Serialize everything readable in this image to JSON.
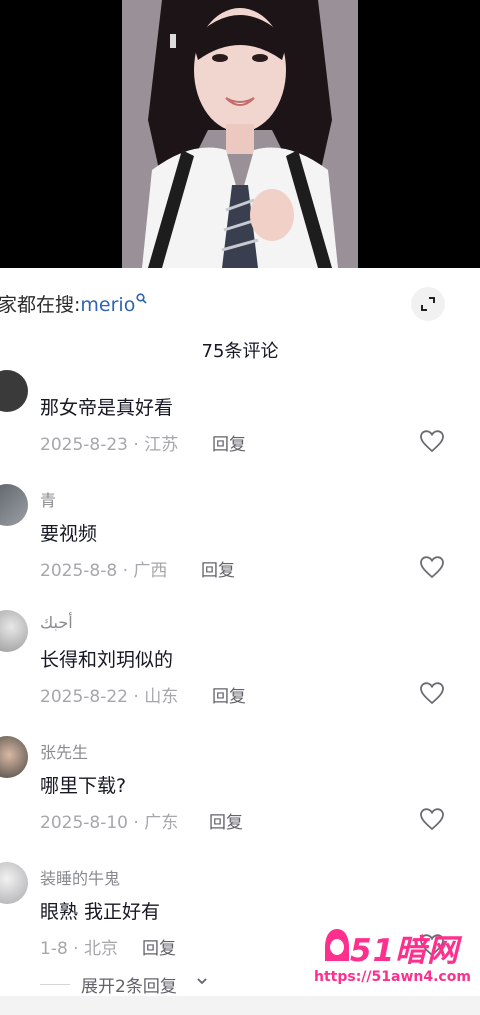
{
  "search": {
    "prefix": "家都在搜:",
    "term": "merio"
  },
  "comments_header": {
    "count_label": "75条评论"
  },
  "comments": [
    {
      "username": "",
      "text": "那女帝是真好看",
      "meta": "2025-8-23 · 江苏",
      "reply_label": "回复"
    },
    {
      "username": "青",
      "text": "要视频",
      "meta": "2025-8-8 · 广西",
      "reply_label": "回复"
    },
    {
      "username": "أحبك",
      "text": "长得和刘玥似的",
      "meta": "2025-8-22 · 山东",
      "reply_label": "回复"
    },
    {
      "username": "张先生",
      "text": "哪里下载?",
      "meta": "2025-8-10 · 广东",
      "reply_label": "回复"
    },
    {
      "username": "装睡的牛鬼",
      "text": "眼熟 我正好有",
      "meta": "1-8 · 北京",
      "reply_label": "回复"
    }
  ],
  "expand_replies": {
    "label": "展开2条回复"
  },
  "watermark": {
    "logo_text": "51暗网",
    "url": "https://51awn4.com"
  },
  "icons": {
    "search": "search-icon",
    "expand": "expand-icon",
    "like": "heart-outline-icon",
    "chevron": "chevron-down-icon"
  },
  "colors": {
    "search_term": "#2f64b4",
    "primary_text": "#161823",
    "secondary_text": "#a6a7ab",
    "watermark": "#ff2f8e"
  }
}
